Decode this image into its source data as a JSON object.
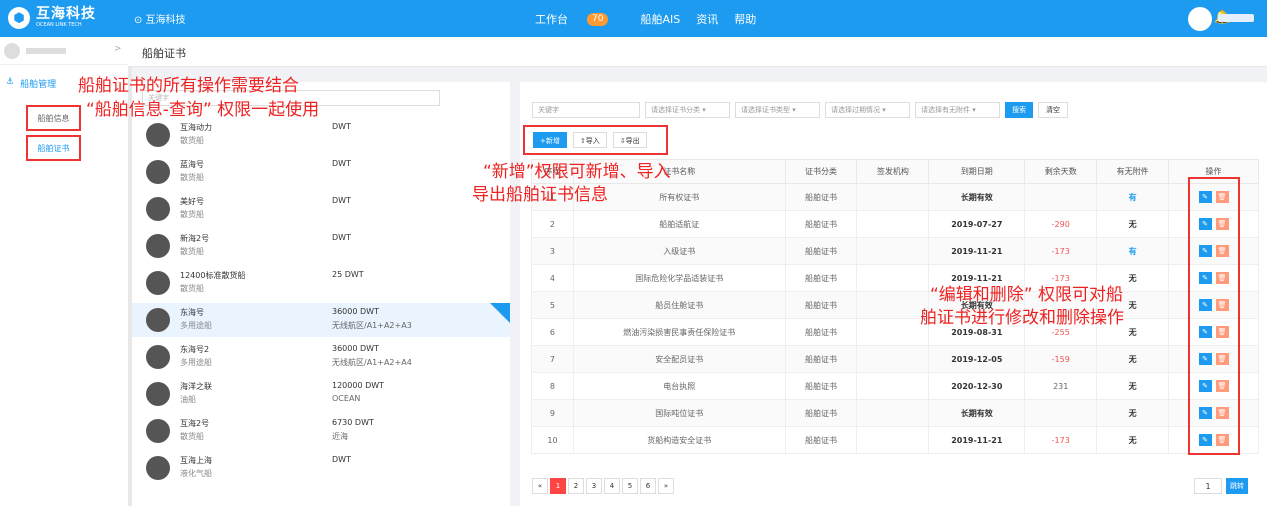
{
  "header": {
    "logo_mark": "⬢",
    "logo_cn": "互海科技",
    "logo_en": "OCEAN LINK TECH",
    "company": "⊙ 互海科技",
    "nav": [
      {
        "label": "工作台",
        "badge": "70"
      },
      {
        "label": "船舶AIS"
      },
      {
        "label": "资讯"
      },
      {
        "label": "帮助"
      }
    ],
    "bell": "🔔"
  },
  "sidebar": {
    "arrow": ">",
    "group_icon": "⚓",
    "group_label": "船舶管理",
    "items": [
      {
        "label": "船舶信息"
      },
      {
        "label": "船舶证书"
      }
    ]
  },
  "page": {
    "title": "船舶证书"
  },
  "shiplist": {
    "search_placeholder": "关键字",
    "ships": [
      {
        "name": "互海动力",
        "type": "散货船",
        "dwt": "DWT",
        "area": ""
      },
      {
        "name": "蓝海号",
        "type": "散货船",
        "dwt": "DWT",
        "area": ""
      },
      {
        "name": "美好号",
        "type": "散货船",
        "dwt": "DWT",
        "area": ""
      },
      {
        "name": "新海2号",
        "type": "散货船",
        "dwt": "DWT",
        "area": ""
      },
      {
        "name": "12400标准散货船",
        "type": "散货船",
        "dwt": "25 DWT",
        "area": ""
      },
      {
        "name": "东海号",
        "type": "多用途船",
        "dwt": "36000 DWT",
        "area": "无线航区/A1+A2+A3"
      },
      {
        "name": "东海号2",
        "type": "多用途船",
        "dwt": "36000 DWT",
        "area": "无线航区/A1+A2+A4"
      },
      {
        "name": "海洋之联",
        "type": "油船",
        "dwt": "120000 DWT",
        "area": "OCEAN"
      },
      {
        "name": "互海2号",
        "type": "散货船",
        "dwt": "6730 DWT",
        "area": "近海"
      },
      {
        "name": "互海上海",
        "type": "液化气船",
        "dwt": "DWT",
        "area": ""
      }
    ]
  },
  "filters": {
    "keyword": "关键字",
    "category": "请选择证书分类 ▾",
    "cert_type": "请选择证书类型 ▾",
    "expiry": "请选择过期情况 ▾",
    "attachment": "请选择有无附件 ▾",
    "search_label": "搜索",
    "clear_label": "清空"
  },
  "actions": {
    "add": "+新增",
    "import": "⇧导入",
    "export": "⇩导出"
  },
  "table": {
    "headers": [
      "序号",
      "证书名称",
      "证书分类",
      "签发机构",
      "到期日期",
      "剩余天数",
      "有无附件",
      "操作"
    ],
    "rows": [
      {
        "no": "1",
        "name": "所有权证书",
        "cat": "船舶证书",
        "org": "",
        "date": "长期有效",
        "days": "",
        "att": "有"
      },
      {
        "no": "2",
        "name": "船舶适航证",
        "cat": "船舶证书",
        "org": "",
        "date": "2019-07-27",
        "days": "-290",
        "att": "无"
      },
      {
        "no": "3",
        "name": "入级证书",
        "cat": "船舶证书",
        "org": "",
        "date": "2019-11-21",
        "days": "-173",
        "att": "有"
      },
      {
        "no": "4",
        "name": "国际危险化学品适装证书",
        "cat": "船舶证书",
        "org": "",
        "date": "2019-11-21",
        "days": "-173",
        "att": "无"
      },
      {
        "no": "5",
        "name": "船员住舱证书",
        "cat": "船舶证书",
        "org": "",
        "date": "长期有效",
        "days": "",
        "att": "无"
      },
      {
        "no": "6",
        "name": "燃油污染损害民事责任保险证书",
        "cat": "船舶证书",
        "org": "",
        "date": "2019-08-31",
        "days": "-255",
        "att": "无"
      },
      {
        "no": "7",
        "name": "安全配员证书",
        "cat": "船舶证书",
        "org": "",
        "date": "2019-12-05",
        "days": "-159",
        "att": "无"
      },
      {
        "no": "8",
        "name": "电台执照",
        "cat": "船舶证书",
        "org": "",
        "date": "2020-12-30",
        "days": "231",
        "att": "无"
      },
      {
        "no": "9",
        "name": "国际吨位证书",
        "cat": "船舶证书",
        "org": "",
        "date": "长期有效",
        "days": "",
        "att": "无"
      },
      {
        "no": "10",
        "name": "货船构造安全证书",
        "cat": "船舶证书",
        "org": "",
        "date": "2019-11-21",
        "days": "-173",
        "att": "无"
      }
    ],
    "edit_icon": "✎",
    "delete_icon": "🗑"
  },
  "pager": {
    "prev": "«",
    "pages": [
      "1",
      "2",
      "3",
      "4",
      "5",
      "6"
    ],
    "next": "»",
    "jump_value": "1",
    "jump_label": "跳转"
  },
  "annotations": {
    "a1": "船舶证书的所有操作需要结合",
    "a2": "“船舶信息-查询” 权限一起使用",
    "a3": "“新增”权限可新增、导入",
    "a4": "导出船舶证书信息",
    "a5": "“编辑和删除” 权限可对船",
    "a6": "舶证书进行修改和删除操作"
  }
}
